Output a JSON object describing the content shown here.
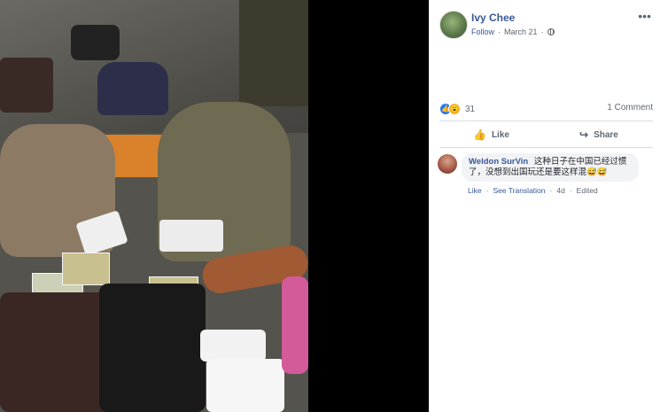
{
  "post": {
    "author": "Ivy Chee",
    "follow_label": "Follow",
    "date": "March 21",
    "privacy_icon": "globe-icon",
    "more_icon": "more-options-icon",
    "more_glyph": "•••",
    "reaction_count": "31",
    "comment_count": "1 Comment",
    "actions": {
      "like_label": "Like",
      "share_label": "Share"
    },
    "colors": {
      "link_blue": "#385898",
      "like_blue": "#2078f4",
      "wow_yellow": "#f7b125"
    }
  },
  "comment": {
    "author": "Weldon SurVin",
    "text": "这种日子在中国已经过惯了，没想到出国玩还是要这样混😅😅",
    "actions": {
      "like_label": "Like",
      "translation_label": "See Translation",
      "age": "4d",
      "edited_label": "Edited"
    }
  }
}
